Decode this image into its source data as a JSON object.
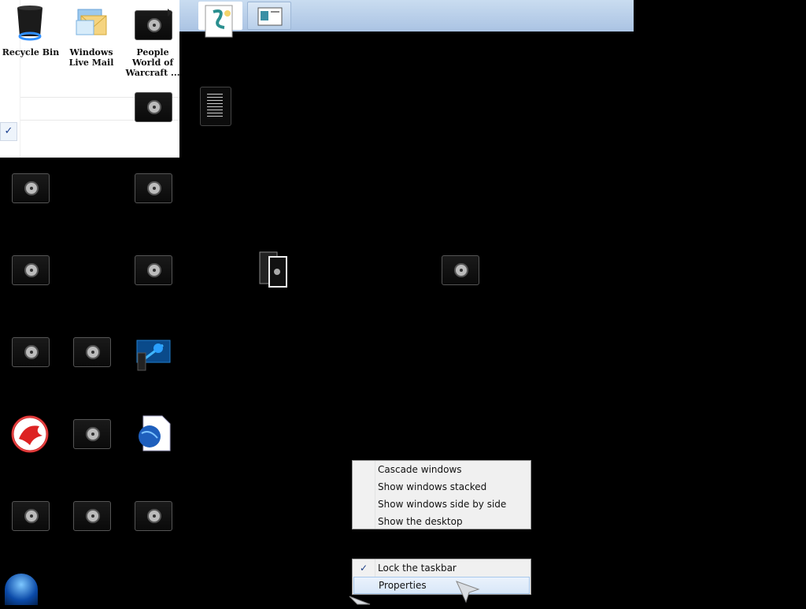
{
  "desktop": {
    "labels": {
      "recycle_bin": "Recycle Bin",
      "windows_live_mail": "Windows Live Mail",
      "people_world": "People World of Warcraft ..."
    }
  },
  "context_menu_windows": {
    "items": [
      {
        "label": "Cascade windows"
      },
      {
        "label": "Show windows stacked"
      },
      {
        "label": "Show windows side by side"
      },
      {
        "label": "Show the desktop"
      }
    ]
  },
  "context_menu_taskbar": {
    "items": [
      {
        "label": "Lock the taskbar",
        "checked": true
      },
      {
        "label": "Properties",
        "highlighted": true
      }
    ],
    "check_glyph": "✓"
  },
  "ghost_check_glyph": "✓",
  "colors": {
    "desktop_bg": "#000000",
    "menu_bg": "#f0f0f0",
    "menu_border": "#979797",
    "highlight": "#d8e7f8",
    "topbar": "#b8cfea"
  }
}
